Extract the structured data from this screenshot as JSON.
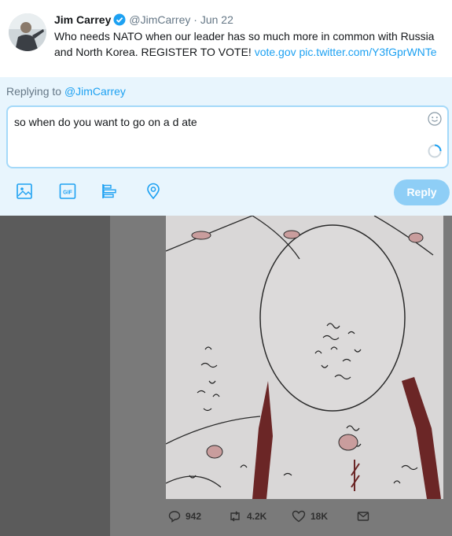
{
  "tweet": {
    "author_name": "Jim Carrey",
    "handle": "@JimCarrey",
    "separator": "·",
    "date": "Jun 22",
    "text": "Who needs NATO when our leader has so much more in common with Russia and North Korea. REGISTER TO VOTE!",
    "link_1": "vote.gov",
    "link_2": "pic.twitter.com/Y3fGprWNTe"
  },
  "reply": {
    "replying_label": "Replying to",
    "replying_mention": "@JimCarrey",
    "text": "so when do you want to go on a d ate",
    "reply_button": "Reply",
    "tools": [
      "image-icon",
      "gif-icon",
      "poll-icon",
      "location-icon"
    ]
  },
  "actions": {
    "replies": "942",
    "retweets": "4.2K",
    "likes": "18K"
  },
  "colors": {
    "accent": "#1da1f2",
    "composer_bg": "#e8f5fd",
    "reply_button_disabled": "#8ecef6"
  }
}
